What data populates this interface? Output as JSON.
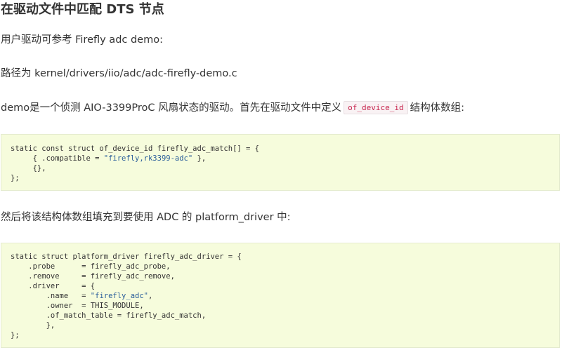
{
  "heading": "在驱动文件中匹配 DTS 节点",
  "para1": "用户驱动可参考 Firefly adc demo:",
  "para2": "路径为 kernel/drivers/iio/adc/adc-firefly-demo.c",
  "para3": {
    "before": "demo是一个侦测 AIO-3399ProC 风扇状态的驱动。首先在驱动文件中定义",
    "code": "of_device_id",
    "after": "结构体数组:"
  },
  "code_block_1": [
    {
      "pre": "static const struct of_device_id firefly_adc_match[] = {",
      "str": "",
      "post": ""
    },
    {
      "pre": "     { .compatible = ",
      "str": "\"firefly,rk3399-adc\"",
      "post": " },"
    },
    {
      "pre": "     {},",
      "str": "",
      "post": ""
    },
    {
      "pre": "};",
      "str": "",
      "post": ""
    }
  ],
  "para4": "然后将该结构体数组填充到要使用 ADC 的 platform_driver 中:",
  "code_block_2": [
    {
      "pre": "static struct platform_driver firefly_adc_driver = {",
      "str": "",
      "post": ""
    },
    {
      "pre": "    .probe      = firefly_adc_probe,",
      "str": "",
      "post": ""
    },
    {
      "pre": "    .remove     = firefly_adc_remove,",
      "str": "",
      "post": ""
    },
    {
      "pre": "    .driver     = {",
      "str": "",
      "post": ""
    },
    {
      "pre": "        .name   = ",
      "str": "\"firefly_adc\"",
      "post": ","
    },
    {
      "pre": "        .owner  = THIS_MODULE,",
      "str": "",
      "post": ""
    },
    {
      "pre": "        .of_match_table = firefly_adc_match,",
      "str": "",
      "post": ""
    },
    {
      "pre": "        },",
      "str": "",
      "post": ""
    },
    {
      "pre": "};",
      "str": "",
      "post": ""
    }
  ]
}
